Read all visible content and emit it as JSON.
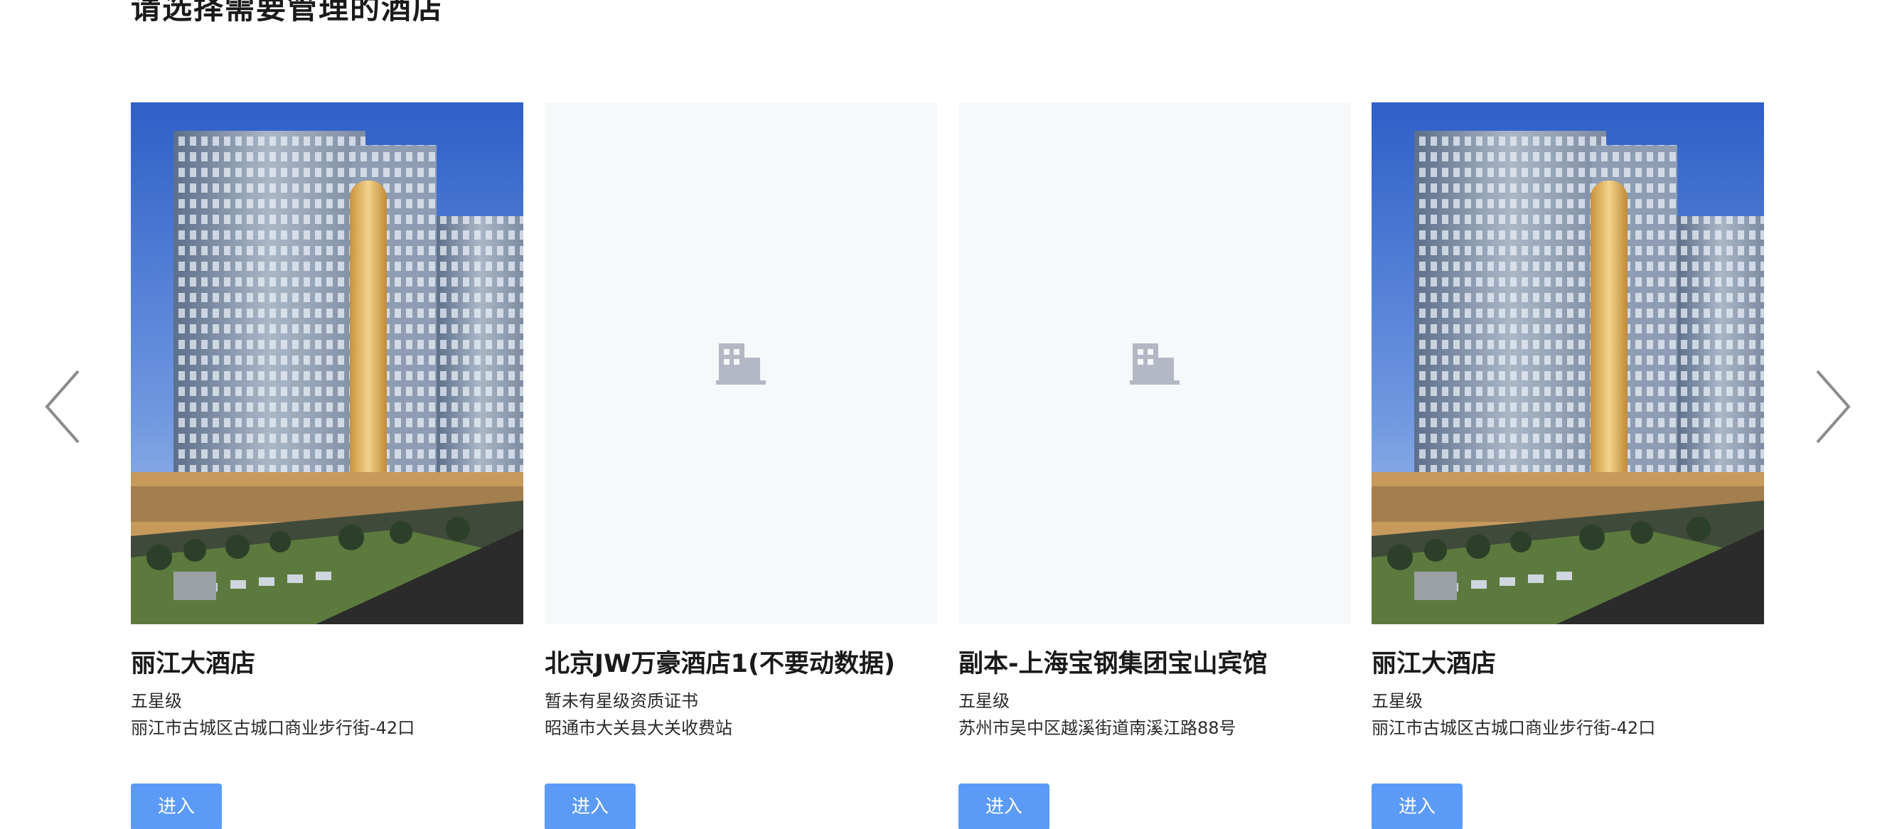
{
  "page": {
    "title": "请选择需要管理的酒店"
  },
  "carousel": {
    "prev_icon": "chevron-left-icon",
    "next_icon": "chevron-right-icon",
    "arrow_color": "#8c8c8c"
  },
  "hotels": [
    {
      "name": "丽江大酒店",
      "star": "五星级",
      "address": "丽江市古城区古城口商业步行街-42口",
      "has_photo": true,
      "button_label": "进入"
    },
    {
      "name": "北京JW万豪酒店1(不要动数据)",
      "star": "暂未有星级资质证书",
      "address": "昭通市大关县大关收费站",
      "has_photo": false,
      "button_label": "进入"
    },
    {
      "name": "副本-上海宝钢集团宝山宾馆",
      "star": "五星级",
      "address": "苏州市吴中区越溪街道南溪江路88号",
      "has_photo": false,
      "button_label": "进入"
    },
    {
      "name": "丽江大酒店",
      "star": "五星级",
      "address": "丽江市古城区古城口商业步行街-42口",
      "has_photo": true,
      "button_label": "进入"
    }
  ],
  "colors": {
    "button_bg": "#5b9bf7",
    "placeholder_bg": "#f7f8fa",
    "placeholder_icon": "#b3b8c4"
  }
}
